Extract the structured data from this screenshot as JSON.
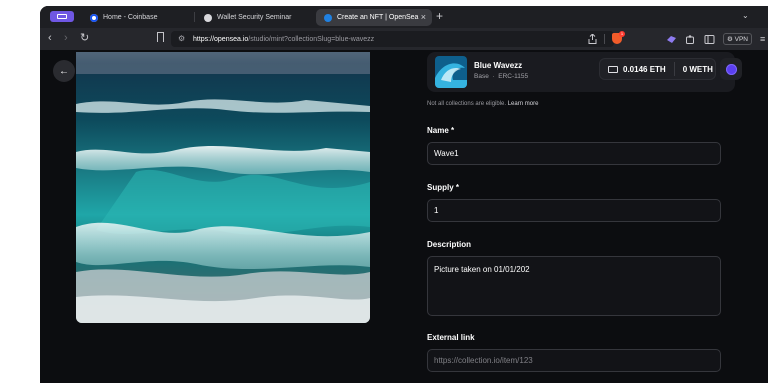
{
  "browser": {
    "tabs": [
      {
        "title": "Home - Coinbase",
        "active": false
      },
      {
        "title": "Wallet Security Seminar",
        "active": false
      },
      {
        "title": "Create an NFT | OpenSea",
        "active": true
      }
    ],
    "close_glyph": "×",
    "new_tab_glyph": "+",
    "tabs_menu_glyph": "⌄",
    "url_domain": "https://opensea.io",
    "url_path": "/studio/mint?collectionSlug=blue-wavezz",
    "vpn_label": "VPN",
    "nav": {
      "back": "‹",
      "forward": "›",
      "reload": "↻"
    },
    "menu_glyph": "≡",
    "brave_badge": "1",
    "accent_color": "#6f57e3"
  },
  "page": {
    "back_glyph": "←",
    "collection": {
      "name": "Blue Wavezz",
      "chain": "Base",
      "separator": "·",
      "standard": "ERC-1155"
    },
    "wallet": {
      "eth_balance": "0.0146 ETH",
      "weth_balance": "0 WETH"
    },
    "eligibility_note": "Not all collections are eligible.",
    "learn_more": "Learn more",
    "form": {
      "name_label": "Name *",
      "name_value": "Wave1",
      "supply_label": "Supply *",
      "supply_value": "1",
      "description_label": "Description",
      "description_value": "Picture taken on 01/01/202",
      "external_link_label": "External link",
      "external_link_placeholder": "https://collection.io/item/123"
    }
  }
}
